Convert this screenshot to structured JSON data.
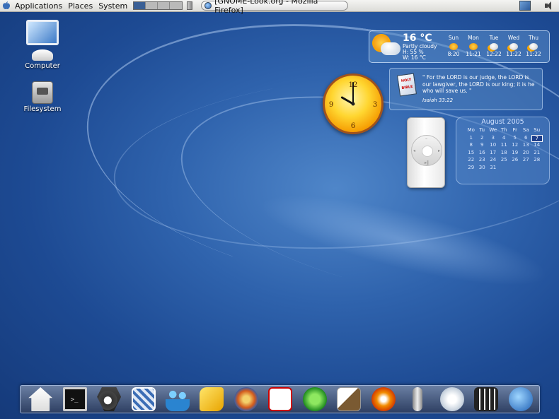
{
  "top_panel": {
    "menus": [
      "Applications",
      "Places",
      "System"
    ],
    "task_title": "[GNOME-Look.org - Mozilla Firefox]"
  },
  "desktop_icons": [
    "Computer",
    "Filesystem"
  ],
  "weather": {
    "temp": "16 °C",
    "condition": "Partly cloudy",
    "humidity": "H: 55 %",
    "wind": "W: 16 °C",
    "days": [
      {
        "name": "Sun",
        "time": "8:20"
      },
      {
        "name": "Mon",
        "time": "11:21"
      },
      {
        "name": "Tue",
        "time": "12:22"
      },
      {
        "name": "Wed",
        "time": "11:22"
      },
      {
        "name": "Thu",
        "time": "11:22"
      }
    ]
  },
  "bible": {
    "book_label": "HOLY BIBLE",
    "verse": "\" For the LORD is our judge, the LORD is our lawgiver, the LORD is our king; it is he who will save us. \"",
    "reference": "Isaiah 33:22"
  },
  "clock": {
    "numerals": [
      "12",
      "3",
      "6",
      "9"
    ],
    "hour": 10,
    "minute": 0
  },
  "calendar": {
    "title": "August 2005",
    "weekdays": [
      "Mo",
      "Tu",
      "We",
      "Th",
      "Fr",
      "Sa",
      "Su"
    ],
    "days": [
      "1",
      "2",
      "3",
      "4",
      "5",
      "6",
      "7",
      "8",
      "9",
      "10",
      "11",
      "12",
      "13",
      "14",
      "15",
      "16",
      "17",
      "18",
      "19",
      "20",
      "21",
      "22",
      "23",
      "24",
      "25",
      "26",
      "27",
      "28",
      "29",
      "30",
      "31"
    ],
    "today": "7"
  },
  "dock": {
    "items": [
      "home-icon",
      "terminal-icon",
      "spy-search-icon",
      "mail-icon",
      "messenger-icon",
      "office-icon",
      "browser-icon",
      "pdf-icon",
      "dreamweaver-icon",
      "gimp-icon",
      "burner-icon",
      "microphone-icon",
      "itunes-icon",
      "movie-icon",
      "network-icon"
    ]
  }
}
